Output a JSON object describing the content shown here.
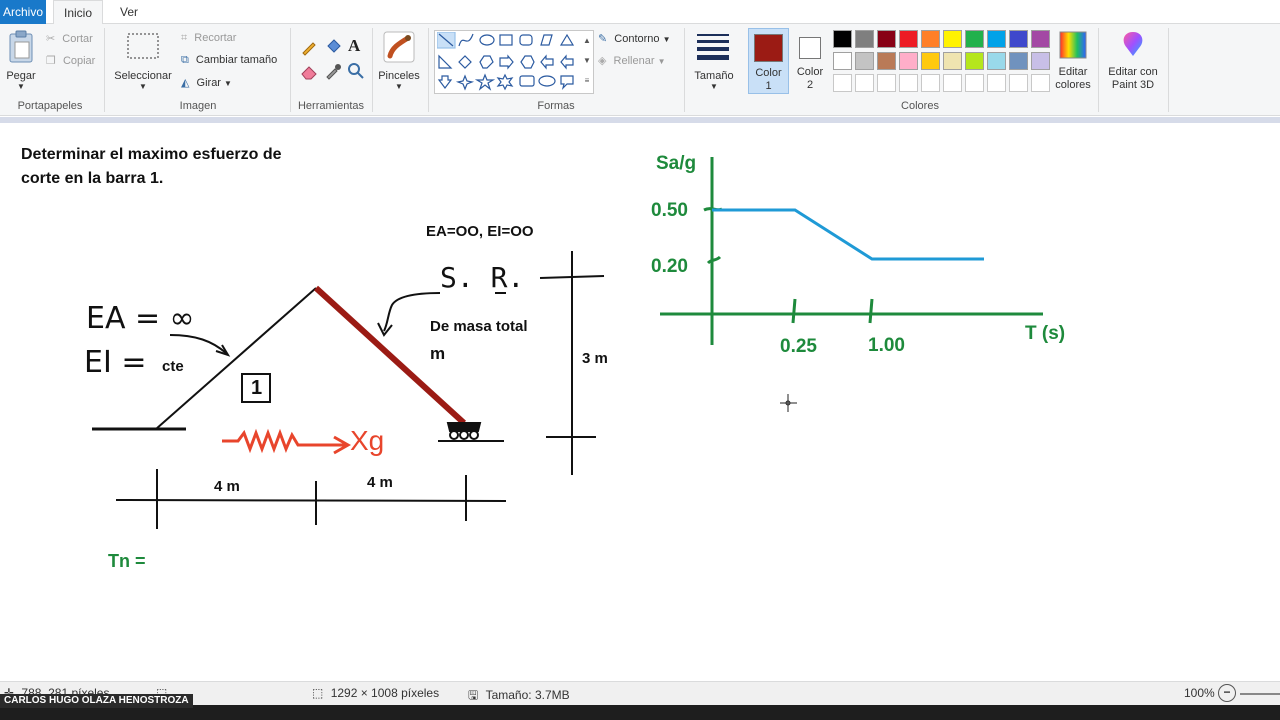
{
  "tabs": {
    "file": "Archivo",
    "home": "Inicio",
    "view": "Ver"
  },
  "clipboard": {
    "paste": "Pegar",
    "cut": "Cortar",
    "copy": "Copiar",
    "group": "Portapapeles"
  },
  "image": {
    "select": "Seleccionar",
    "crop": "Recortar",
    "resize": "Cambiar tamaño",
    "rotate": "Girar",
    "group": "Imagen"
  },
  "tools": {
    "group": "Herramientas"
  },
  "brushes": {
    "label": "Pinceles"
  },
  "shapes": {
    "outline": "Contorno",
    "fill": "Rellenar",
    "group": "Formas"
  },
  "size": {
    "label": "Tamaño"
  },
  "colors": {
    "color1_label": "Color",
    "color1_num": "1",
    "color2_label": "Color",
    "color2_num": "2",
    "edit": "Editar",
    "edit2": "colores",
    "group": "Colores",
    "color1": "#9b1b14",
    "color2": "#ffffff",
    "palette_row1": [
      "#000000",
      "#7f7f7f",
      "#880015",
      "#ed1c24",
      "#ff7f27",
      "#fff200",
      "#22b14c",
      "#00a2e8",
      "#3f48cc",
      "#a349a4"
    ],
    "palette_row2": [
      "#ffffff",
      "#c3c3c3",
      "#b97a57",
      "#ffaec9",
      "#ffc90e",
      "#efe4b0",
      "#b5e61d",
      "#99d9ea",
      "#7092be",
      "#c8bfe7"
    ],
    "palette_row3": [
      "#ffffff",
      "#ffffff",
      "#ffffff",
      "#ffffff",
      "#ffffff",
      "#ffffff",
      "#ffffff",
      "#ffffff",
      "#ffffff",
      "#ffffff"
    ]
  },
  "paint3d": {
    "line1": "Editar con",
    "line2": "Paint 3D"
  },
  "drawing": {
    "problem_line1": "Determinar el maximo esfuerzo de",
    "problem_line2": "corte en la barra 1.",
    "ea_ei_label": "EA=OO, EI=OO",
    "sr_label": "S. R.",
    "mass_line1": "De masa total",
    "mass_line2": "m",
    "height": "3 m",
    "ea_hand": "EA = ∞",
    "ei_hand": "EI =",
    "cte": "cte",
    "bar_number": "1",
    "span1": "4 m",
    "span2": "4 m",
    "excitation": "Xg",
    "tn": "Tn ="
  },
  "chart_data": {
    "type": "line",
    "ylabel": "Sa/g",
    "xlabel": "T (s)",
    "xticks": [
      "0.25",
      "1.00"
    ],
    "yticks": [
      "0.50",
      "0.20"
    ],
    "x": [
      0,
      0.25,
      1.0,
      1.8
    ],
    "values": [
      0.5,
      0.5,
      0.2,
      0.2
    ],
    "line_color": "#1f9ad6",
    "axis_color": "#1e8a3c"
  },
  "status": {
    "cursor": "788, 281 píxeles",
    "dimensions": "1292 × 1008 píxeles",
    "size": "Tamaño: 3.7MB",
    "zoom": "100%",
    "credit": "CARLOS HUGO OLAZA HENOSTROZA"
  }
}
